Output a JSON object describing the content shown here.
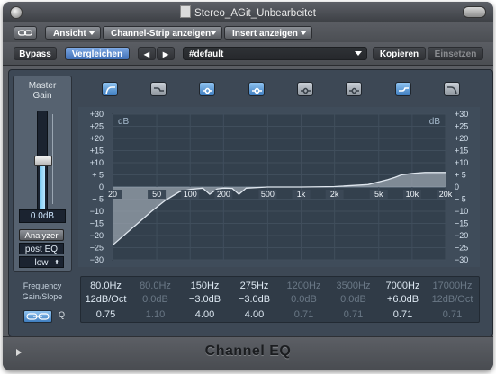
{
  "window": {
    "title": "Stereo_AGit_Unbearbeitet"
  },
  "toolbar": {
    "link_icon": "chain-link-icon",
    "view_menu": "Ansicht",
    "channel_strip_menu": "Channel-Strip anzeigen",
    "insert_menu": "Insert anzeigen",
    "bypass": "Bypass",
    "compare": "Vergleichen",
    "prev_arrow": "◀",
    "next_arrow": "▶",
    "preset": "#default",
    "copy": "Kopieren",
    "paste": "Einsetzen"
  },
  "left_panel": {
    "master_gain_label": [
      "Master",
      "Gain"
    ],
    "gain_value": "0.0dB",
    "gain_level": 0.5,
    "analyzer": "Analyzer",
    "mode": "post EQ",
    "resolution": "low"
  },
  "bands": [
    {
      "icon": "lowcut-filter-icon",
      "active": true
    },
    {
      "icon": "lowshelf-filter-icon",
      "active": false
    },
    {
      "icon": "parametric-bell-icon",
      "active": true
    },
    {
      "icon": "parametric-bell-icon",
      "active": true
    },
    {
      "icon": "parametric-bell-icon",
      "active": false
    },
    {
      "icon": "parametric-bell-icon",
      "active": false
    },
    {
      "icon": "highshelf-filter-icon",
      "active": true
    },
    {
      "icon": "highcut-filter-icon",
      "active": false
    }
  ],
  "graph": {
    "db_ticks": [
      "+30",
      "+25",
      "+20",
      "+15",
      "+10",
      "+ 5",
      "0",
      "− 5",
      "−10",
      "−15",
      "−20",
      "−25",
      "−30"
    ],
    "db_label": "dB",
    "freq_ticks": [
      "20",
      "50",
      "100",
      "200",
      "500",
      "1k",
      "2k",
      "5k",
      "10k",
      "20k"
    ]
  },
  "chart_data": {
    "type": "line",
    "xlabel": "",
    "ylabel": "dB",
    "xscale": "log",
    "xlim": [
      20,
      20000
    ],
    "ylim": [
      -30,
      30
    ],
    "series": [
      {
        "x": [
          20,
          30,
          45,
          60,
          80,
          100,
          130,
          150,
          175,
          200,
          240,
          275,
          320,
          500,
          1000,
          2000,
          4000,
          6000,
          7000,
          8000,
          10000,
          13000,
          20000
        ],
        "y": [
          -24,
          -17,
          -10,
          -5.5,
          -2,
          -1,
          -0.5,
          -3,
          -0.8,
          -0.5,
          -0.6,
          -3,
          -0.5,
          0,
          0,
          0.2,
          1,
          3,
          4,
          5,
          5.6,
          6,
          6
        ]
      }
    ]
  },
  "params": {
    "row_labels": [
      "Frequency",
      "Gain/Slope",
      "Q"
    ],
    "frequency": [
      "80.0Hz",
      "80.0Hz",
      "150Hz",
      "275Hz",
      "1200Hz",
      "3500Hz",
      "7000Hz",
      "17000Hz"
    ],
    "gain": [
      "12dB/Oct",
      "0.0dB",
      "−3.0dB",
      "−3.0dB",
      "0.0dB",
      "0.0dB",
      "+6.0dB",
      "12dB/Oct"
    ],
    "q": [
      "0.75",
      "1.10",
      "4.00",
      "4.00",
      "0.71",
      "0.71",
      "0.71",
      "0.71"
    ],
    "link_icon": "link-icon"
  },
  "footer": {
    "title": "Channel EQ"
  }
}
